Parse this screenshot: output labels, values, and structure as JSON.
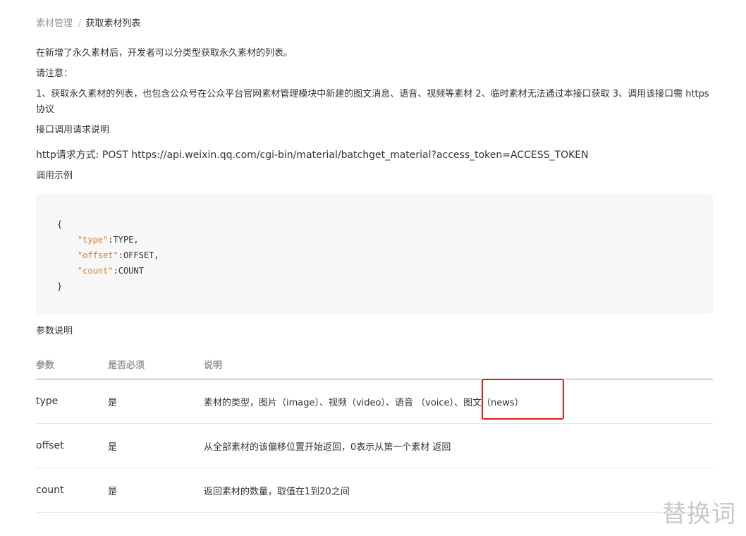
{
  "breadcrumb": {
    "parent": "素材管理",
    "separator": "/",
    "current": "获取素材列表"
  },
  "content": {
    "intro": "在新增了永久素材后，开发者可以分类型获取永久素材的列表。",
    "notice_label": "请注意：",
    "notes": "1、获取永久素材的列表，也包含公众号在公众平台官网素材管理模块中新建的图文消息、语音、视频等素材 2、临时素材无法通过本接口获取 3、调用该接口需 https 协议",
    "request_title": "接口调用请求说明",
    "http_request": "http请求方式: POST https://api.weixin.qq.com/cgi-bin/material/batchget_material?access_token=ACCESS_TOKEN",
    "example_title": "调用示例",
    "params_title": "参数说明"
  },
  "code_example": {
    "open_brace": "{",
    "close_brace": "}",
    "lines": [
      {
        "key": "\"type\"",
        "sep": ":",
        "value": "TYPE,"
      },
      {
        "key": "\"offset\"",
        "sep": ":",
        "value": "OFFSET,"
      },
      {
        "key": "\"count\"",
        "sep": ":",
        "value": "COUNT"
      }
    ]
  },
  "params_table": {
    "headers": {
      "param": "参数",
      "required": "是否必须",
      "description": "说明"
    },
    "rows": [
      {
        "param": "type",
        "required": "是",
        "description": "素材的类型，图片（image）、视频（video）、语音 （voice）、图文（news）"
      },
      {
        "param": "offset",
        "required": "是",
        "description": "从全部素材的该偏移位置开始返回，0表示从第一个素材 返回"
      },
      {
        "param": "count",
        "required": "是",
        "description": "返回素材的数量，取值在1到20之间"
      }
    ]
  },
  "watermark": {
    "text": "替换词"
  },
  "colors": {
    "highlight_border": "#e02020",
    "code_key": "#e67e22",
    "code_background": "#f7f7f7"
  }
}
